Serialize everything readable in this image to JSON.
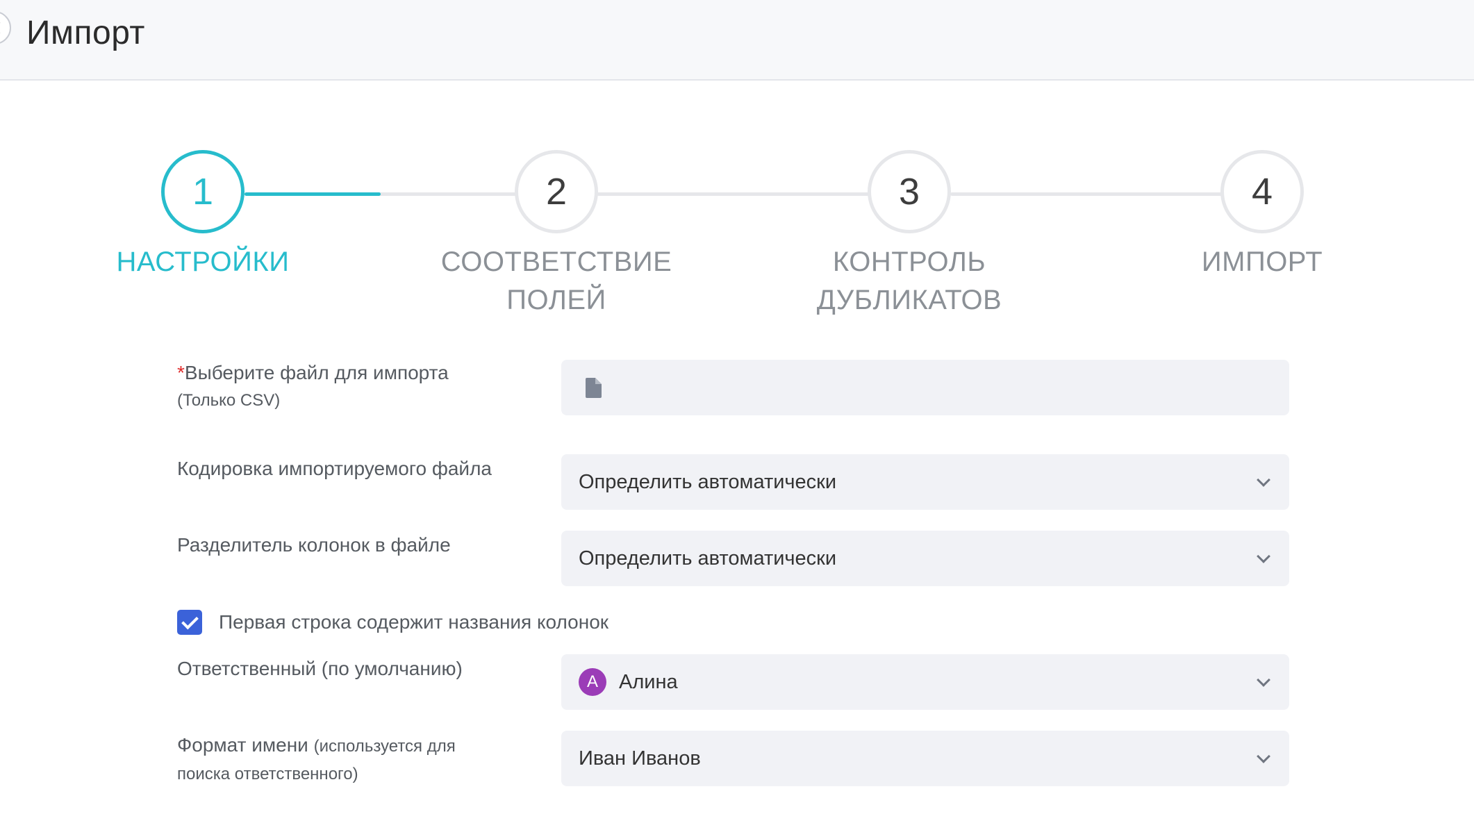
{
  "header": {
    "title": "Импорт"
  },
  "stepper": {
    "steps": [
      {
        "number": "1",
        "label_line1": "НАСТРОЙКИ",
        "label_line2": "",
        "active": true
      },
      {
        "number": "2",
        "label_line1": "СООТВЕТСТВИЕ",
        "label_line2": "ПОЛЕЙ",
        "active": false
      },
      {
        "number": "3",
        "label_line1": "КОНТРОЛЬ",
        "label_line2": "ДУБЛИКАТОВ",
        "active": false
      },
      {
        "number": "4",
        "label_line1": "ИМПОРТ",
        "label_line2": "",
        "active": false
      }
    ],
    "colors": {
      "active": "#27bccc",
      "inactive_circle": "#e6e7ea",
      "inactive_label": "#8b9096"
    }
  },
  "form": {
    "file": {
      "required_mark": "*",
      "label": "Выберите файл для импорта",
      "hint": "(Только CSV)",
      "value": "",
      "icon": "file-icon"
    },
    "encoding": {
      "label": "Кодировка импортируемого файла",
      "value": "Определить автоматически"
    },
    "delimiter": {
      "label": "Разделитель колонок в файле",
      "value": "Определить автоматически"
    },
    "header_row": {
      "label": "Первая строка содержит названия колонок",
      "checked": true
    },
    "responsible": {
      "label": "Ответственный (по умолчанию)",
      "avatar_letter": "А",
      "avatar_color": "#9b3cb7",
      "value": "Алина"
    },
    "name_format": {
      "label": "Формат имени",
      "hint_line1": "(используется для",
      "hint_line2": "поиска ответственного)",
      "value": "Иван Иванов"
    }
  }
}
